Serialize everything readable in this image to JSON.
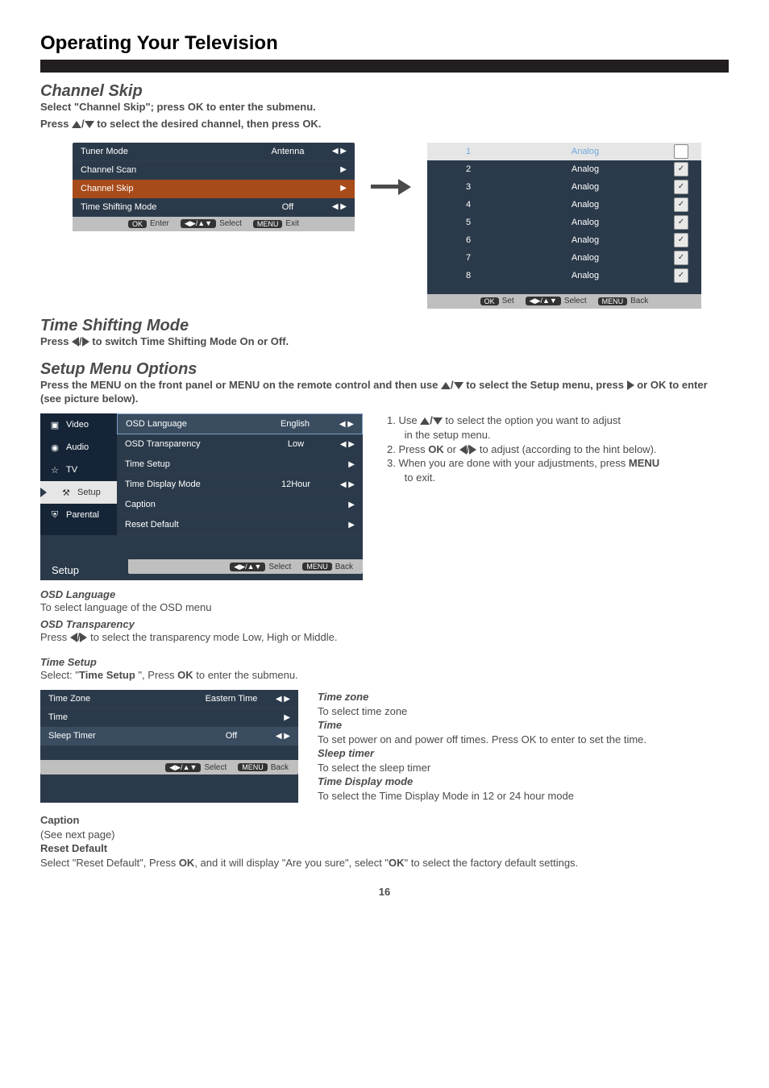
{
  "page_number": "16",
  "main_heading": "Operating Your Television",
  "channel_skip": {
    "title": "Channel Skip",
    "line1_pre": "Select \"",
    "line1_bold": "Channel Skip",
    "line1_post": "\"; press ",
    "line1_ok": "OK",
    "line1_end": " to enter the submenu.",
    "line2_pre": "Press ",
    "line2_post": " to select the desired channel, then press OK."
  },
  "tuner_panel": {
    "rows": [
      {
        "label": "Tuner Mode",
        "value": "Antenna",
        "arrows": "◀ ▶"
      },
      {
        "label": "Channel Scan",
        "value": "",
        "arrows": "▶"
      },
      {
        "label": "Channel Skip",
        "value": "",
        "arrows": "▶",
        "highlight": true
      },
      {
        "label": "Time Shifting Mode",
        "value": "Off",
        "arrows": "◀ ▶"
      }
    ],
    "footer": {
      "ok": "OK",
      "enter": "Enter",
      "sel_icon": "◀▶/▲▼",
      "sel": "Select",
      "menu": "MENU",
      "exit": "Exit"
    }
  },
  "channel_list": {
    "rows": [
      {
        "num": "1",
        "type": "Analog",
        "checked": false,
        "highlight": true
      },
      {
        "num": "2",
        "type": "Analog",
        "checked": true
      },
      {
        "num": "3",
        "type": "Analog",
        "checked": true
      },
      {
        "num": "4",
        "type": "Analog",
        "checked": true
      },
      {
        "num": "5",
        "type": "Analog",
        "checked": true
      },
      {
        "num": "6",
        "type": "Analog",
        "checked": true
      },
      {
        "num": "7",
        "type": "Analog",
        "checked": true
      },
      {
        "num": "8",
        "type": "Analog",
        "checked": true
      }
    ],
    "footer": {
      "ok": "OK",
      "set": "Set",
      "sel_icon": "◀▶/▲▼",
      "sel": "Select",
      "menu": "MENU",
      "back": "Back"
    }
  },
  "time_shifting": {
    "title": "Time Shifting Mode",
    "line_pre": "Press ",
    "line_post": " to switch Time Shifting Mode On or Off."
  },
  "setup_menu_opts": {
    "title": "Setup Menu Options",
    "line1_a": "Press the ",
    "line1_menu1": "MENU",
    "line1_b": " on the front panel or ",
    "line1_menu2": "MENU",
    "line1_c": " on the remote control and then use ",
    "line1_d": " to select the Setup menu, press ",
    "line1_or": " or ",
    "line1_ok": "OK",
    "line1_e": " to enter (see picture below)."
  },
  "setup_panel": {
    "sidebar": [
      {
        "label": "Video",
        "icon": "video-icon"
      },
      {
        "label": "Audio",
        "icon": "audio-icon"
      },
      {
        "label": "TV",
        "icon": "tv-icon"
      },
      {
        "label": "Setup",
        "icon": "setup-icon",
        "active": true
      },
      {
        "label": "Parental",
        "icon": "parental-icon"
      }
    ],
    "rows": [
      {
        "label": "OSD Language",
        "value": "English",
        "arrows": "◀ ▶",
        "selected": true
      },
      {
        "label": "OSD Transparency",
        "value": "Low",
        "arrows": "◀ ▶"
      },
      {
        "label": "Time Setup",
        "value": "",
        "arrows": "▶"
      },
      {
        "label": "Time Display Mode",
        "value": "12Hour",
        "arrows": "◀ ▶"
      },
      {
        "label": "Caption",
        "value": "",
        "arrows": "▶"
      },
      {
        "label": "Reset Default",
        "value": "",
        "arrows": "▶"
      }
    ],
    "bottom": "Setup",
    "footer": {
      "sel_icon": "◀▶/▲▼",
      "sel": "Select",
      "menu": "MENU",
      "back": "Back"
    }
  },
  "setup_steps": {
    "s1a": "1.   Use ",
    "s1b": " to select the option you want to adjust",
    "s1c": "      in the setup menu.",
    "s2a": "2.   Press ",
    "s2ok": "OK",
    "s2b": " or ",
    "s2c": " to adjust (according to the hint below).",
    "s3a": "3.   When you are done with your adjustments, press ",
    "s3menu": "MENU",
    "s3b": "      to exit."
  },
  "osd_lang": {
    "title": "OSD Language",
    "text": "To select language of the OSD menu"
  },
  "osd_trans": {
    "title": "OSD Transparency",
    "pre": "Press ",
    "post": " to select the transparency mode Low, High or Middle."
  },
  "time_setup": {
    "title": "Time Setup",
    "line_a": "Select: \"",
    "line_bold": "Time Setup",
    "line_b": " \", Press ",
    "line_ok": "OK",
    "line_c": " to enter the submenu."
  },
  "time_panel": {
    "rows": [
      {
        "label": "Time Zone",
        "value": "Eastern Time",
        "arrows": "◀ ▶"
      },
      {
        "label": "Time",
        "value": "",
        "arrows": "▶"
      },
      {
        "label": "Sleep Timer",
        "value": "Off",
        "arrows": "◀ ▶"
      }
    ],
    "footer": {
      "sel_icon": "◀▶/▲▼",
      "sel": "Select",
      "menu": "MENU",
      "back": "Back"
    }
  },
  "time_desc": {
    "zone_t": "Time zone",
    "zone_d": "To select time zone",
    "time_t": "Time",
    "time_d": "To set power on and power off times. Press OK to enter to set the time.",
    "sleep_t": "Sleep timer",
    "sleep_d": "To select the sleep timer",
    "disp_t": "Time Display mode",
    "disp_d": "To select the Time Display Mode in 12 or 24 hour mode"
  },
  "caption": {
    "title": "Caption",
    "sub": "(See next page)"
  },
  "reset": {
    "title": "Reset Default",
    "text_a": "Select \"Reset Default\", Press ",
    "text_ok": "OK",
    "text_b": ", and it will display \"Are you sure\", select \"",
    "text_ok2": "OK",
    "text_c": "\" to select the factory default settings."
  }
}
